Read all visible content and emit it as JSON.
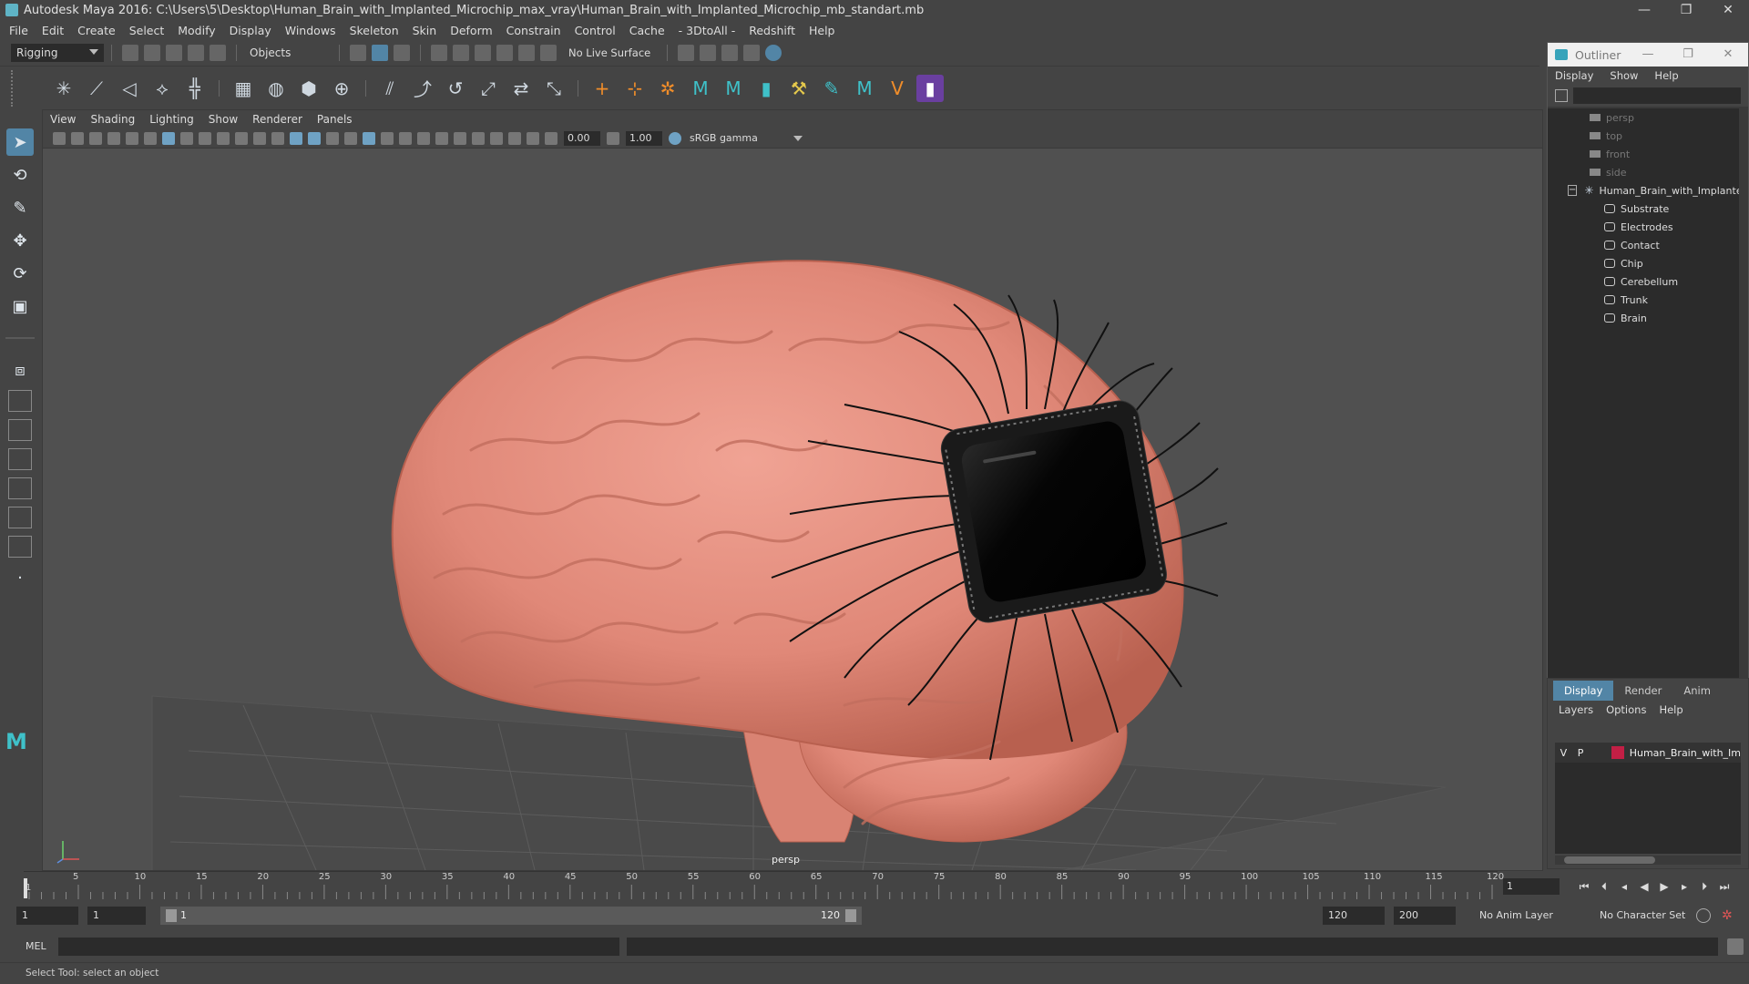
{
  "window": {
    "title": "Autodesk Maya 2016: C:\\Users\\5\\Desktop\\Human_Brain_with_Implanted_Microchip_max_vray\\Human_Brain_with_Implanted_Microchip_mb_standart.mb",
    "minimize": "—",
    "restore": "❐",
    "close": "✕"
  },
  "menubar": [
    "File",
    "Edit",
    "Create",
    "Select",
    "Modify",
    "Display",
    "Windows",
    "Skeleton",
    "Skin",
    "Deform",
    "Constrain",
    "Control",
    "Cache",
    "- 3DtoAll -",
    "Redshift",
    "Help"
  ],
  "statusline": {
    "menuset": "Rigging",
    "select_mode": "Objects",
    "live_surface": "No Live Surface"
  },
  "viewport": {
    "menu": [
      "View",
      "Shading",
      "Lighting",
      "Show",
      "Renderer",
      "Panels"
    ],
    "exposure": "0.00",
    "gamma": "1.00",
    "color_space": "sRGB gamma",
    "camera_label": "persp"
  },
  "outliner": {
    "title": "Outliner",
    "menu": [
      "Display",
      "Show",
      "Help"
    ],
    "cameras": [
      "persp",
      "top",
      "front",
      "side"
    ],
    "group": "Human_Brain_with_Implanted_Microchip",
    "children": [
      "Substrate",
      "Electrodes",
      "Contact",
      "Chip",
      "Cerebellum",
      "Trunk",
      "Brain"
    ]
  },
  "layers": {
    "tabs": [
      "Display",
      "Render",
      "Anim"
    ],
    "menu": [
      "Layers",
      "Options",
      "Help"
    ],
    "row": {
      "v": "V",
      "p": "P",
      "name": "Human_Brain_with_Im",
      "color": "#c21f45"
    }
  },
  "timeline": {
    "ticks": [
      "5",
      "10",
      "15",
      "20",
      "25",
      "30",
      "35",
      "40",
      "45",
      "50",
      "55",
      "60",
      "65",
      "70",
      "75",
      "80",
      "85",
      "90",
      "95",
      "100",
      "105",
      "110",
      "115",
      "120"
    ],
    "start_tick": "1",
    "current_frame": "1"
  },
  "range": {
    "start": "1",
    "playback_start": "1",
    "range_start_label": "1",
    "range_end_label": "120",
    "playback_end": "120",
    "end": "200",
    "anim_layer": "No Anim Layer",
    "character_set": "No Character Set"
  },
  "command": {
    "label": "MEL"
  },
  "help_line": "Select Tool: select an object"
}
